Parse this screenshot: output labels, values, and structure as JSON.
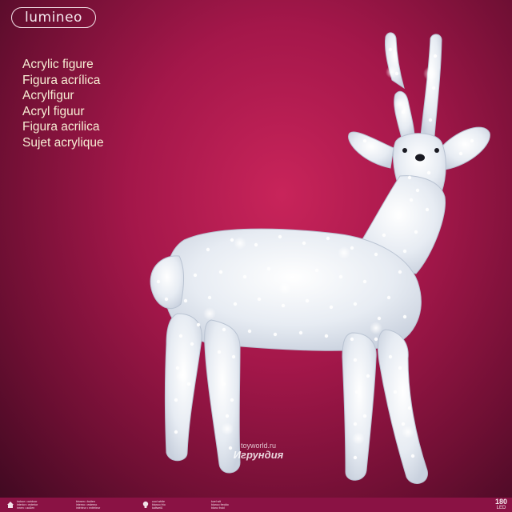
{
  "brand": {
    "name": "lumineo"
  },
  "product_names": [
    "Acrylic figure",
    "Figura acrílica",
    "Acrylfigur",
    "Acryl figuur",
    "Figura acrilica",
    "Sujet acrylique"
  ],
  "watermark": {
    "site": "toyworld.ru",
    "name": "Игрундия"
  },
  "footer": {
    "blocks": [
      {
        "icon": "house-icon",
        "lines": [
          "indoor • outdoor",
          "interior • exterior",
          "innen • außen"
        ]
      },
      {
        "icon": "none",
        "lines": [
          "binnen • buiten",
          "interno • esterno",
          "intérieur • extérieur"
        ]
      },
      {
        "icon": "bulb-icon",
        "lines": [
          "cool white",
          "blanco frío",
          "kaltweiß"
        ]
      },
      {
        "icon": "none",
        "lines": [
          "koel wit",
          "bianco freddo",
          "blanc froid"
        ]
      }
    ],
    "led_count": "180",
    "led_unit": "LED"
  },
  "colors": {
    "background": "#a4174a",
    "text": "#f7eed4",
    "figure": "#eef2f7"
  }
}
